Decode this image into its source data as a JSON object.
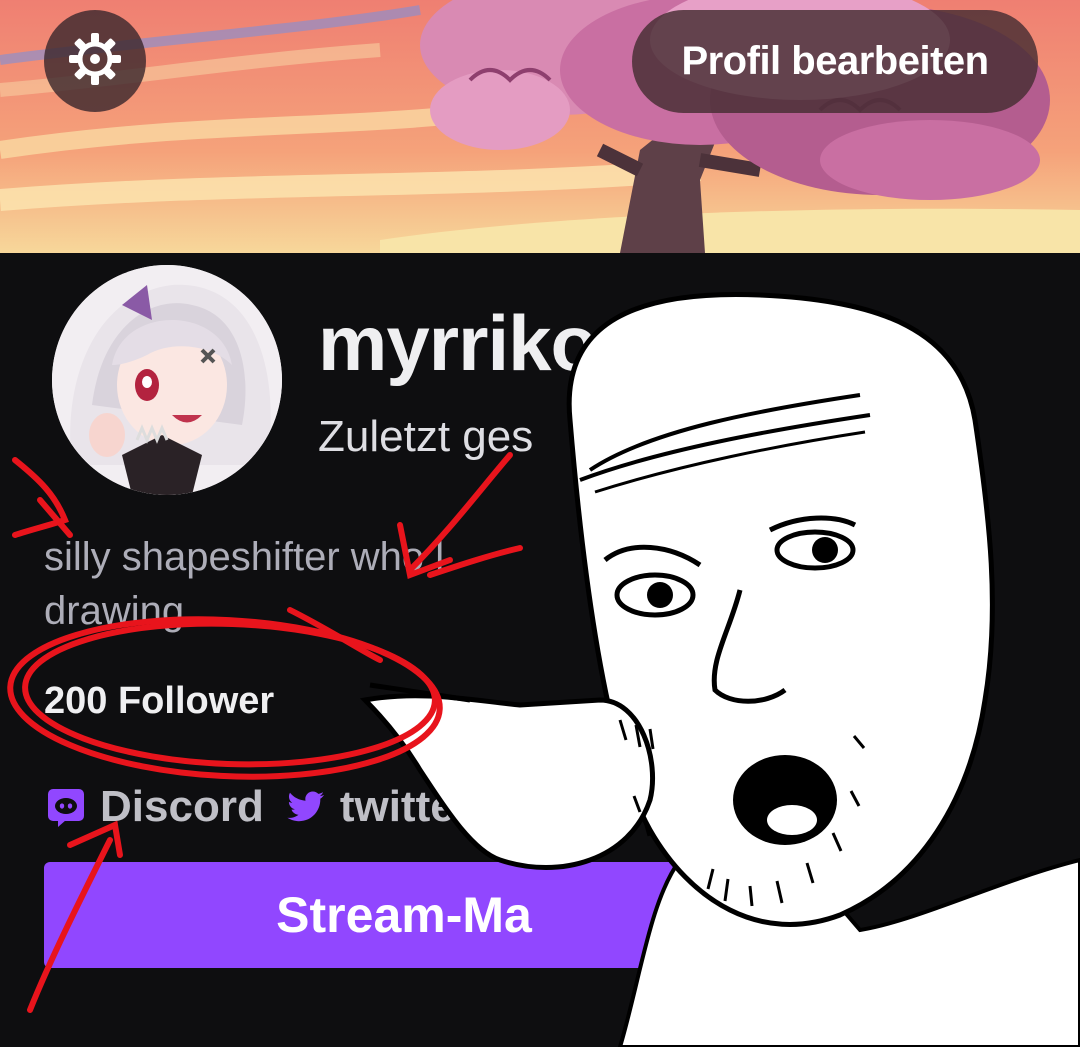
{
  "header": {
    "edit_profile_label": "Profil bearbeiten"
  },
  "profile": {
    "username": "myrriko",
    "last_seen": "Zuletzt ges",
    "bio": "silly shapeshifter who l\ndrawing",
    "followers": "200 Follower"
  },
  "socials": [
    {
      "label": "Discord",
      "icon": "discord-icon"
    },
    {
      "label": "twitter",
      "icon": "twitter-icon"
    }
  ],
  "stream_button_label": "Stream-Ma",
  "colors": {
    "background": "#0e0e10",
    "accent": "#9147ff",
    "annotation_red": "#e8141c"
  }
}
